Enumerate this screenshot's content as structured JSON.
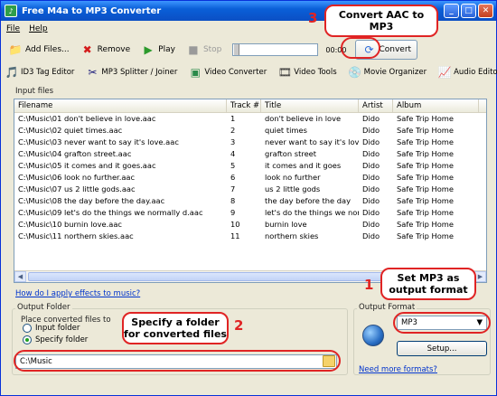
{
  "window": {
    "title": "Free M4a to MP3 Converter"
  },
  "menu": {
    "file": "File",
    "help": "Help"
  },
  "toolbar": {
    "add_files": "Add Files...",
    "remove": "Remove",
    "play": "Play",
    "stop": "Stop",
    "time": "00:00",
    "convert": "Convert"
  },
  "tools": [
    {
      "label": "ID3 Tag Editor",
      "icon": "id3-tag-icon"
    },
    {
      "label": "MP3 Splitter / Joiner",
      "icon": "splitter-icon"
    },
    {
      "label": "Video Converter",
      "icon": "video-converter-icon"
    },
    {
      "label": "Video Tools",
      "icon": "film-icon"
    },
    {
      "label": "Movie Organizer",
      "icon": "movie-organizer-icon"
    },
    {
      "label": "Audio Editor",
      "icon": "audio-editor-icon"
    }
  ],
  "input_files": {
    "label": "Input files",
    "columns": [
      "Filename",
      "Track #",
      "Title",
      "Artist",
      "Album"
    ],
    "rows": [
      [
        "C:\\Music\\01 don't believe in love.aac",
        "1",
        "don't believe in love",
        "Dido",
        "Safe Trip Home"
      ],
      [
        "C:\\Music\\02 quiet times.aac",
        "2",
        "quiet times",
        "Dido",
        "Safe Trip Home"
      ],
      [
        "C:\\Music\\03 never want to say it's love.aac",
        "3",
        "never want to say it's love",
        "Dido",
        "Safe Trip Home"
      ],
      [
        "C:\\Music\\04 grafton street.aac",
        "4",
        "grafton street",
        "Dido",
        "Safe Trip Home"
      ],
      [
        "C:\\Music\\05 it comes and it goes.aac",
        "5",
        "it comes and it goes",
        "Dido",
        "Safe Trip Home"
      ],
      [
        "C:\\Music\\06 look no further.aac",
        "6",
        "look no further",
        "Dido",
        "Safe Trip Home"
      ],
      [
        "C:\\Music\\07 us 2 little gods.aac",
        "7",
        "us 2 little gods",
        "Dido",
        "Safe Trip Home"
      ],
      [
        "C:\\Music\\08 the day before the day.aac",
        "8",
        "the day before the day",
        "Dido",
        "Safe Trip Home"
      ],
      [
        "C:\\Music\\09 let's do the things we normally d.aac",
        "9",
        "let's do the things we normally do",
        "Dido",
        "Safe Trip Home"
      ],
      [
        "C:\\Music\\10 burnin love.aac",
        "10",
        "burnin love",
        "Dido",
        "Safe Trip Home"
      ],
      [
        "C:\\Music\\11 northern skies.aac",
        "11",
        "northern skies",
        "Dido",
        "Safe Trip Home"
      ]
    ]
  },
  "effects_link": "How do I apply effects to music?",
  "output_folder": {
    "label": "Output Folder",
    "place_label": "Place converted files to",
    "option_input": "Input folder",
    "option_specify": "Specify folder",
    "path": "C:\\Music"
  },
  "output_format": {
    "label": "Output Format",
    "selected": "MP3",
    "setup": "Setup...",
    "more_link": "Need more formats?"
  },
  "callouts": {
    "c3_num": "3",
    "c3_text": "Convert AAC to MP3",
    "c1_num": "1",
    "c1_text": "Set MP3 as output format",
    "c2_num": "2",
    "c2_text": "Specify a folder for converted files"
  },
  "colors": {
    "accent": "#e02424",
    "title_bar": "#0a5fd8",
    "link": "#0033cc"
  }
}
